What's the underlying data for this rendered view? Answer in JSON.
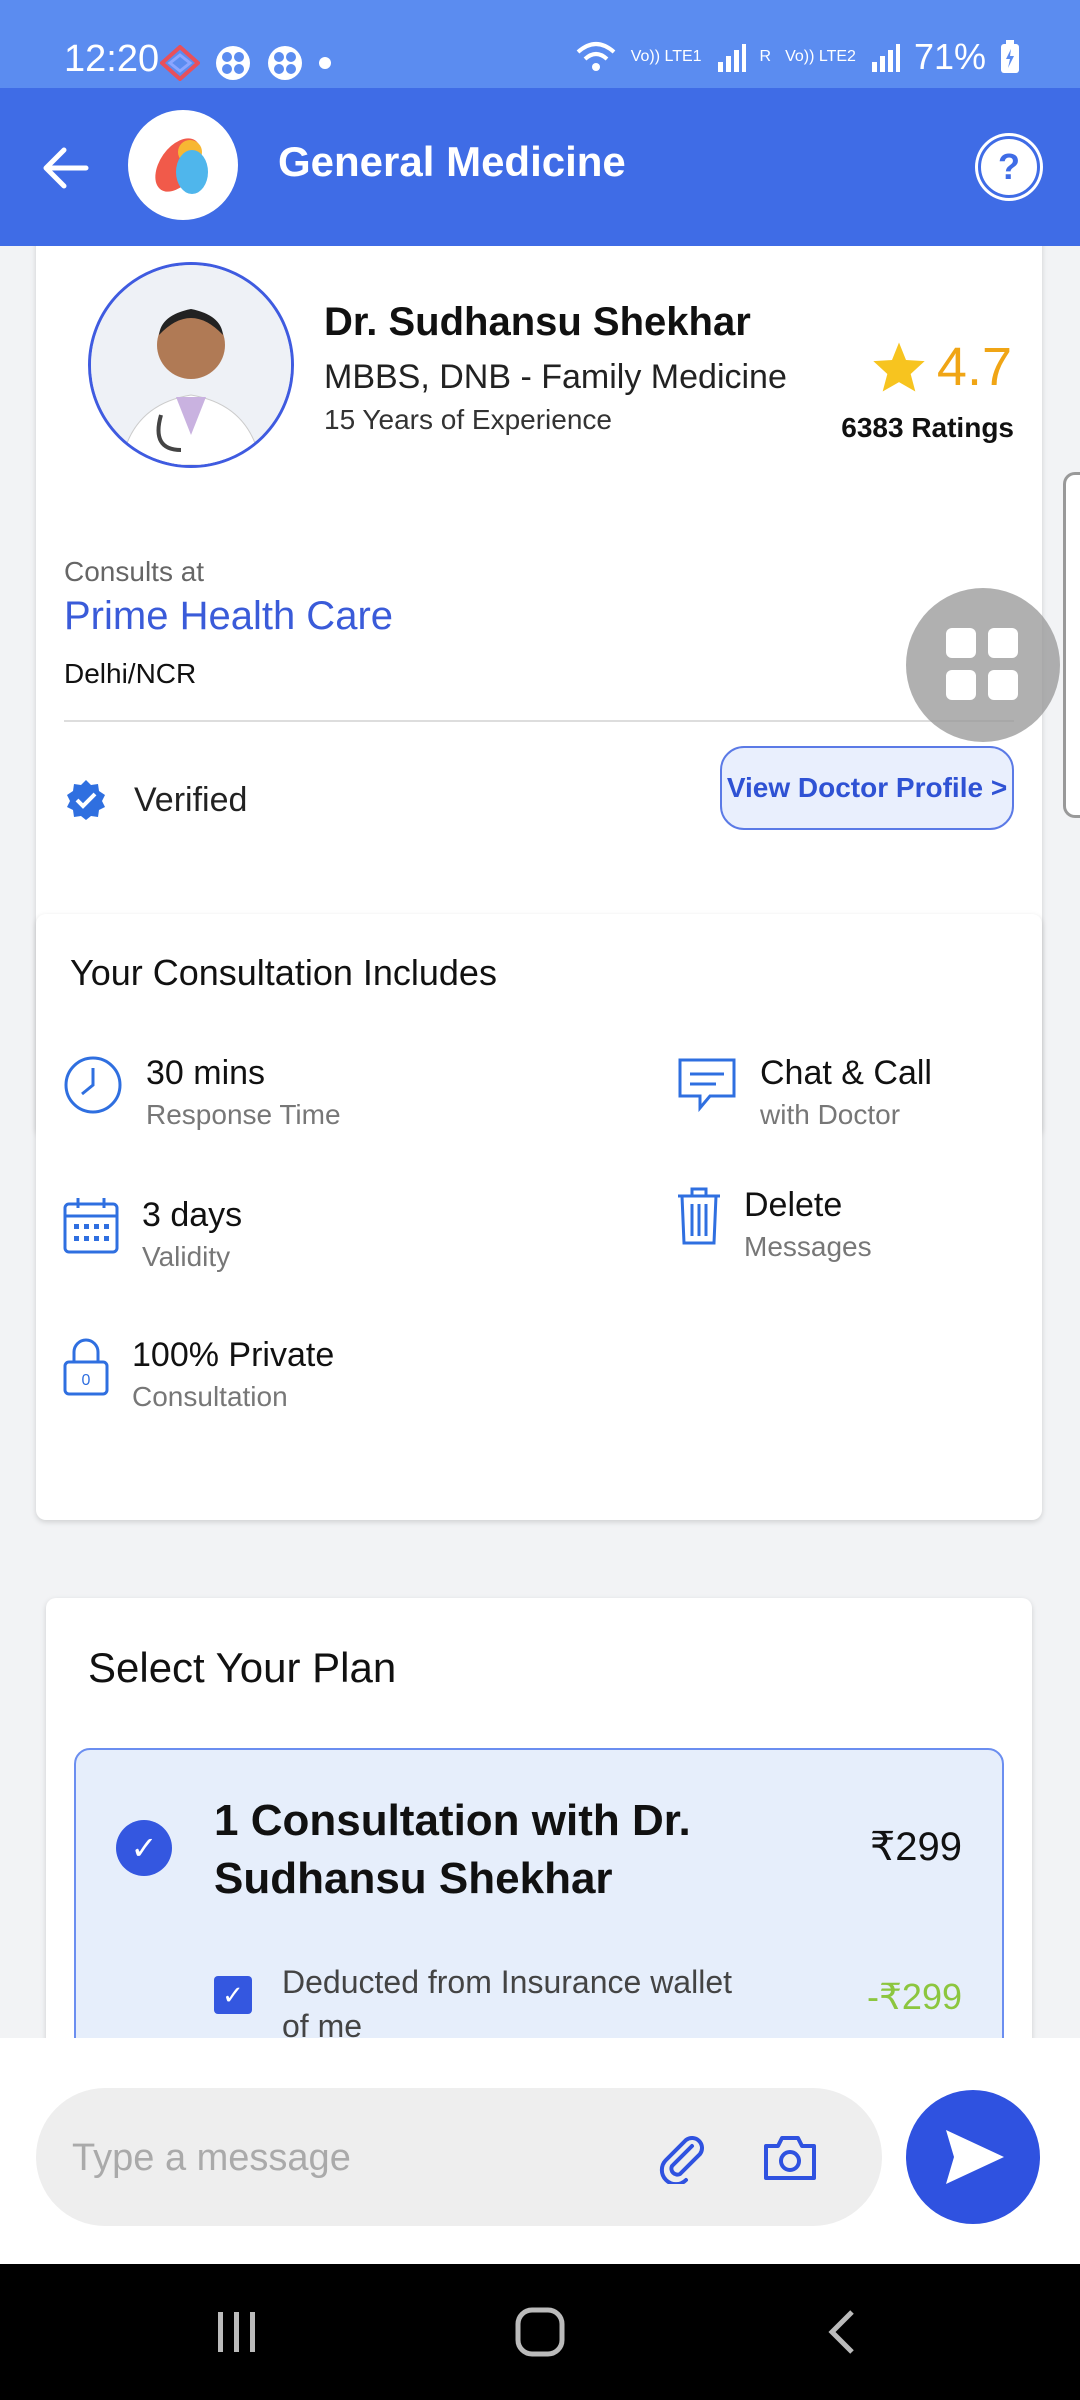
{
  "status_bar": {
    "time": "12:20",
    "battery": "71%",
    "network_labels": [
      "Vo)) LTE1",
      "R",
      "Vo)) LTE2"
    ]
  },
  "header": {
    "title": "General Medicine",
    "help_label": "?"
  },
  "doctor": {
    "name": "Dr. Sudhansu Shekhar",
    "degree": "MBBS, DNB - Family Medicine",
    "experience": "15 Years of Experience",
    "rating": "4.7",
    "ratings_count": "6383 Ratings",
    "consults_label": "Consults at",
    "clinic": "Prime Health Care",
    "city": "Delhi/NCR",
    "verified_label": "Verified",
    "view_profile_label": "View Doctor Profile >"
  },
  "consultation": {
    "title": "Your Consultation Includes",
    "features": [
      {
        "title": "30 mins",
        "subtitle": "Response Time",
        "icon": "clock-icon"
      },
      {
        "title": "Chat & Call",
        "subtitle": "with Doctor",
        "icon": "chat-icon"
      },
      {
        "title": "3 days",
        "subtitle": "Validity",
        "icon": "calendar-icon"
      },
      {
        "title": "Delete",
        "subtitle": "Messages",
        "icon": "trash-icon"
      },
      {
        "title": "100% Private",
        "subtitle": "Consultation",
        "icon": "lock-icon"
      }
    ]
  },
  "plan_section": {
    "title": "Select Your Plan",
    "plan_name": "1 Consultation with Dr. Sudhansu Shekhar",
    "price": "₹299",
    "deduction_label": "Deducted from Insurance wallet of me",
    "deduction_amount": "-₹299"
  },
  "message_input": {
    "placeholder": "Type a message"
  },
  "colors": {
    "primary": "#3f6ce6",
    "status_bar": "#5b8cf0",
    "rating": "#f0a515",
    "deduction": "#8cc63f"
  }
}
